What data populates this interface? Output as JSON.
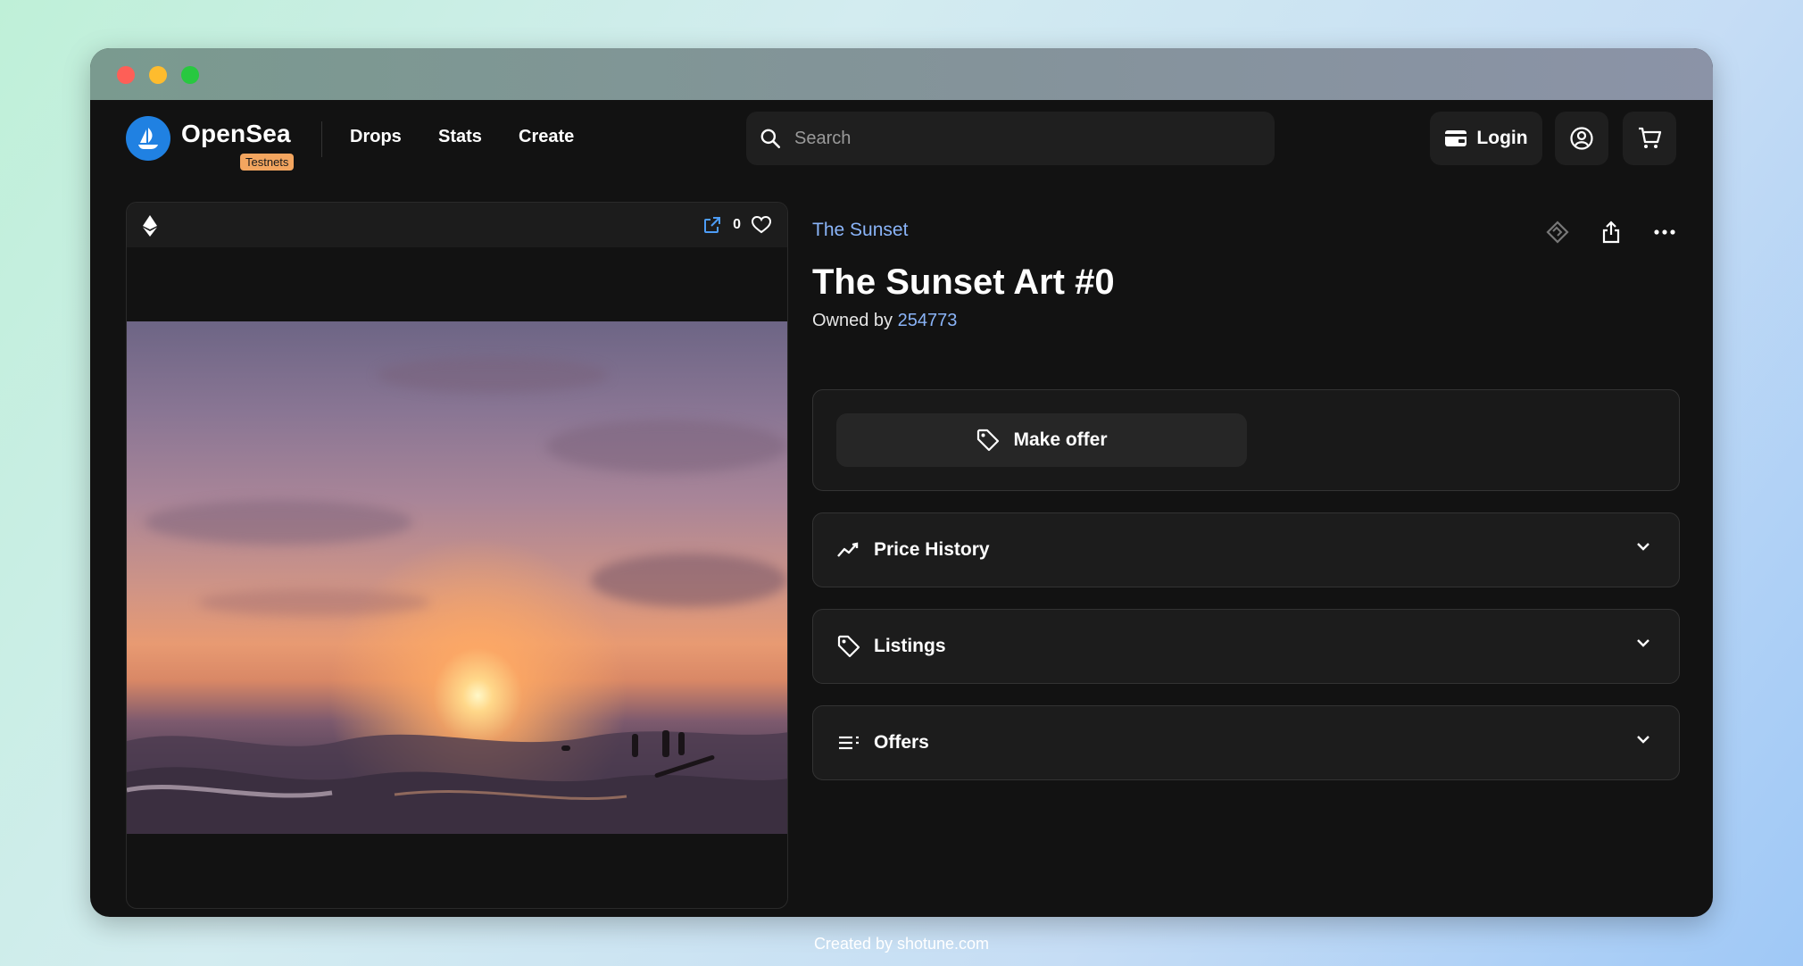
{
  "navbar": {
    "brand": "OpenSea",
    "badge": "Testnets",
    "links": [
      "Drops",
      "Stats",
      "Create"
    ],
    "search_placeholder": "Search",
    "login_label": "Login"
  },
  "media": {
    "likes": "0"
  },
  "item": {
    "collection": "The Sunset",
    "title": "The Sunset Art #0",
    "owned_by_prefix": "Owned by ",
    "owner": "254773"
  },
  "actions": {
    "make_offer": "Make offer"
  },
  "sections": [
    {
      "label": "Price History",
      "icon": "trending-line-icon"
    },
    {
      "label": "Listings",
      "icon": "tag-icon"
    },
    {
      "label": "Offers",
      "icon": "list-icon"
    }
  ],
  "footer": "Created by shotune.com",
  "colors": {
    "accent_blue": "#2081e2",
    "link_blue": "#8ab4f8",
    "badge_orange": "#f3a55f",
    "background": "#121212"
  }
}
